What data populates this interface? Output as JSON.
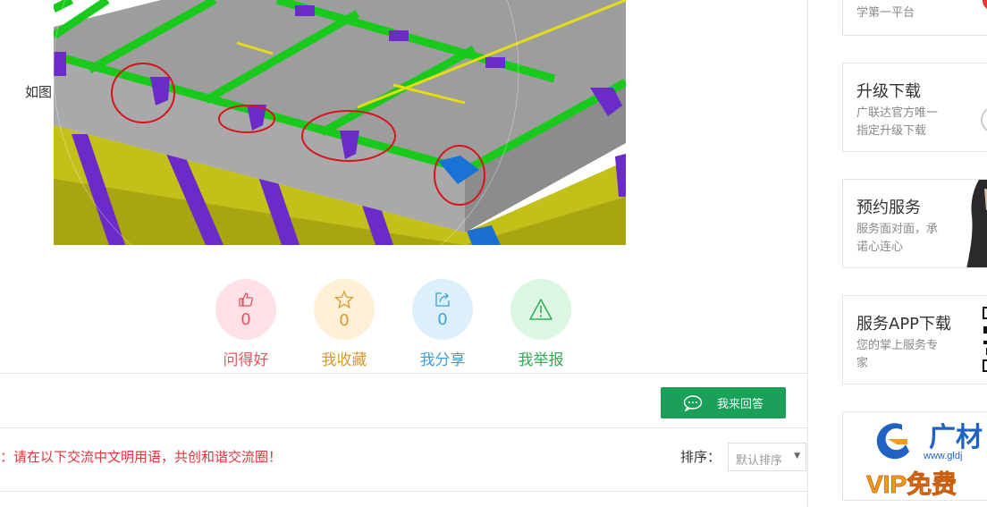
{
  "content": {
    "caption_prefix": "如图"
  },
  "actions": [
    {
      "label": "问得好",
      "count": "0",
      "icon": "thumbs-up-icon",
      "color": "#e4555f"
    },
    {
      "label": "我收藏",
      "count": "0",
      "icon": "star-icon",
      "color": "#d99a31"
    },
    {
      "label": "我分享",
      "count": "0",
      "icon": "share-icon",
      "color": "#3f9fd6"
    },
    {
      "label": "我举报",
      "count": "0",
      "icon": "warning-icon",
      "color": "#2fae56"
    }
  ],
  "answer_button": {
    "label": "我来回答",
    "icon": "chat-bubble-icon",
    "color": "#1aa058"
  },
  "notice": "：请在以下交流中文明用语，共创和谐交流圈！",
  "sort": {
    "label": "排序：",
    "selected": "默认排序"
  },
  "sidebar": {
    "cards": [
      {
        "title": "",
        "desc": "学第一平台"
      },
      {
        "title": "升级下载",
        "desc": "广联达官方唯一指定升级下载"
      },
      {
        "title": "预约服务",
        "desc": "服务面对面，承诺心连心"
      },
      {
        "title": "服务APP下载",
        "desc": "您的掌上服务专家"
      }
    ],
    "banner": {
      "logo_text": "广材",
      "url_text": "www.gldj",
      "promo_text": "VIP免费"
    }
  }
}
